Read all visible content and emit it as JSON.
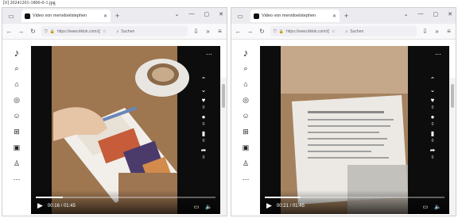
{
  "caption": "[0] 20241201-1800-0-1.jpg",
  "windows": [
    {
      "tab_title": "Video von mervdoelstephen",
      "url": "https://www.tiktok.com/@...",
      "search_placeholder": "Suchen",
      "time": "00:16 / 01:45",
      "progress": 0.15,
      "like_count": "0",
      "comment_count": "0",
      "save_count": "0",
      "share_count": "0"
    },
    {
      "tab_title": "Video von mervdoelstephen",
      "url": "https://www.tiktok.com/@...",
      "search_placeholder": "Suchen",
      "time": "00:21 / 01:45",
      "progress": 0.2,
      "like_count": "0",
      "comment_count": "0",
      "save_count": "0",
      "share_count": "0"
    }
  ],
  "colors": {
    "tab_bg": "#ececf0",
    "nav_bg": "#f9f9fb",
    "video_bg": "#0b0b0b"
  },
  "icons": {
    "home": "home-icon",
    "explore": "compass-icon",
    "following": "following-icon",
    "upload": "upload-icon",
    "live": "live-icon",
    "profile": "profile-icon",
    "more": "more-icon"
  }
}
